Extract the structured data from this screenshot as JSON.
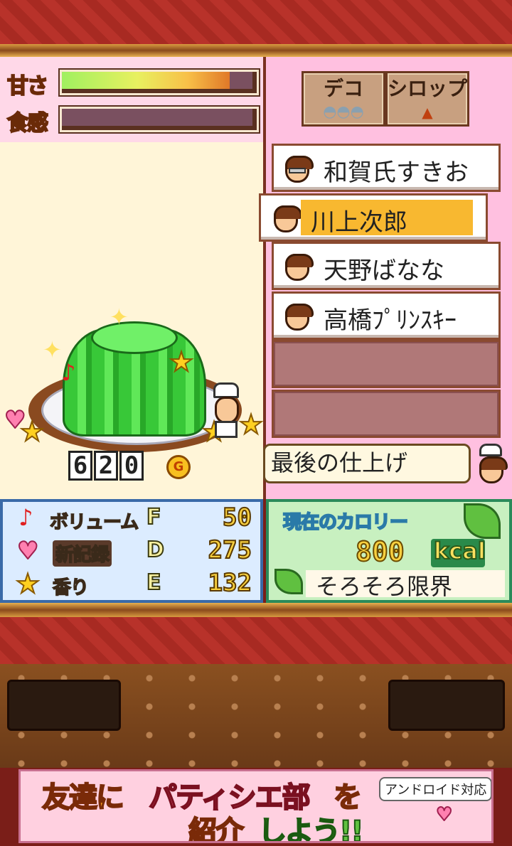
{
  "meters": {
    "sweet_label": "甘さ",
    "texture_label": "食感",
    "sweet_level": 0.88,
    "texture_level": 0.0
  },
  "tabs": {
    "deco": "デコ",
    "syrup": "シロップ"
  },
  "judges": [
    {
      "name": "和賀氏すきお",
      "selected": false
    },
    {
      "name": "川上次郎",
      "selected": true
    },
    {
      "name": "天野ばなな",
      "selected": false
    },
    {
      "name": "高橋ﾌﾟﾘﾝｽｷｰ",
      "selected": false
    },
    {
      "name": "",
      "selected": false
    },
    {
      "name": "",
      "selected": false
    }
  ],
  "price": {
    "digits": [
      "6",
      "2",
      "0"
    ],
    "currency": "G"
  },
  "bubble": {
    "text": "最後の仕上げ"
  },
  "stats": [
    {
      "icon": "music-note-icon",
      "label": "ボリューム",
      "grade": "F",
      "value": "50"
    },
    {
      "icon": "heart-icon",
      "label": "新記録",
      "grade": "D",
      "value": "275"
    },
    {
      "icon": "star-icon",
      "label": "香り",
      "grade": "E",
      "value": "132"
    }
  ],
  "calories": {
    "title": "現在のカロリー",
    "value": "800",
    "unit": "kcal",
    "status": "そろそろ限界"
  },
  "ad": {
    "line1a": "友達に",
    "line1b": "パティシエ部",
    "line1c": "を",
    "line2a": "紹介",
    "line2b": "しよう!!",
    "tag": "アンドロイド対応"
  },
  "colors": {
    "accent": "#f8a020",
    "selected_highlight": "#f8b830"
  }
}
